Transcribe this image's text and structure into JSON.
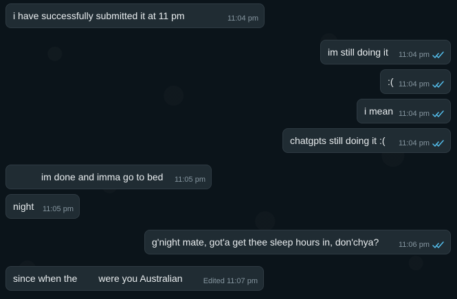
{
  "conversation": {
    "messages": [
      {
        "text": "i have successfully submitted it at 11 pm",
        "time": "11:04 pm",
        "sender": "incoming"
      },
      {
        "text": "im still doing it",
        "time": "11:04 pm",
        "sender": "outgoing"
      },
      {
        "text": ":(",
        "time": "11:04 pm",
        "sender": "outgoing"
      },
      {
        "text": "i mean",
        "time": "11:04 pm",
        "sender": "outgoing"
      },
      {
        "text": "chatgpts still doing it :(",
        "time": "11:04 pm",
        "sender": "outgoing"
      },
      {
        "text": "im done and imma go to bed",
        "time": "11:05 pm",
        "sender": "incoming"
      },
      {
        "text": "night",
        "time": "11:05 pm",
        "sender": "incoming"
      },
      {
        "text": "g'night mate, got'a get thee sleep hours in, don'chya?",
        "time": "11:06 pm",
        "sender": "outgoing"
      },
      {
        "text_parts": [
          "since when the",
          "were you Australian"
        ],
        "time": "Edited 11:07 pm",
        "sender": "incoming"
      }
    ]
  },
  "icons": {
    "read_receipt": "double-check-icon"
  },
  "colors": {
    "background": "#0b141a",
    "bubble": "#202c33",
    "border": "#2f3b43",
    "text": "#e9edef",
    "meta": "#8696a0",
    "read_check": "#53bdeb"
  }
}
